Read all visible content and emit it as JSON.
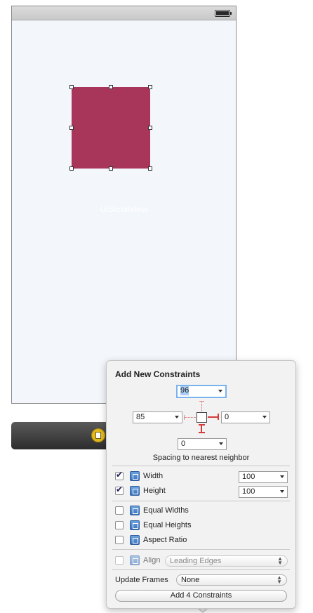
{
  "canvas": {
    "scrollview_label": "UIScrollView"
  },
  "popover": {
    "title": "Add New Constraints",
    "spacing": {
      "top": "96",
      "left": "85",
      "right": "0",
      "bottom": "0"
    },
    "spacing_label": "Spacing to nearest neighbor",
    "rows": [
      {
        "label": "Width",
        "checked": true,
        "value": "100"
      },
      {
        "label": "Height",
        "checked": true,
        "value": "100"
      },
      {
        "label": "Equal Widths",
        "checked": false
      },
      {
        "label": "Equal Heights",
        "checked": false
      },
      {
        "label": "Aspect Ratio",
        "checked": false
      }
    ],
    "align": {
      "label": "Align",
      "option": "Leading Edges"
    },
    "update_frames": {
      "label": "Update Frames",
      "option": "None"
    },
    "add_button": "Add 4 Constraints"
  },
  "colors": {
    "view": "#a8365a",
    "focus": "#7bb3ee",
    "constraint": "#d43b3b"
  }
}
